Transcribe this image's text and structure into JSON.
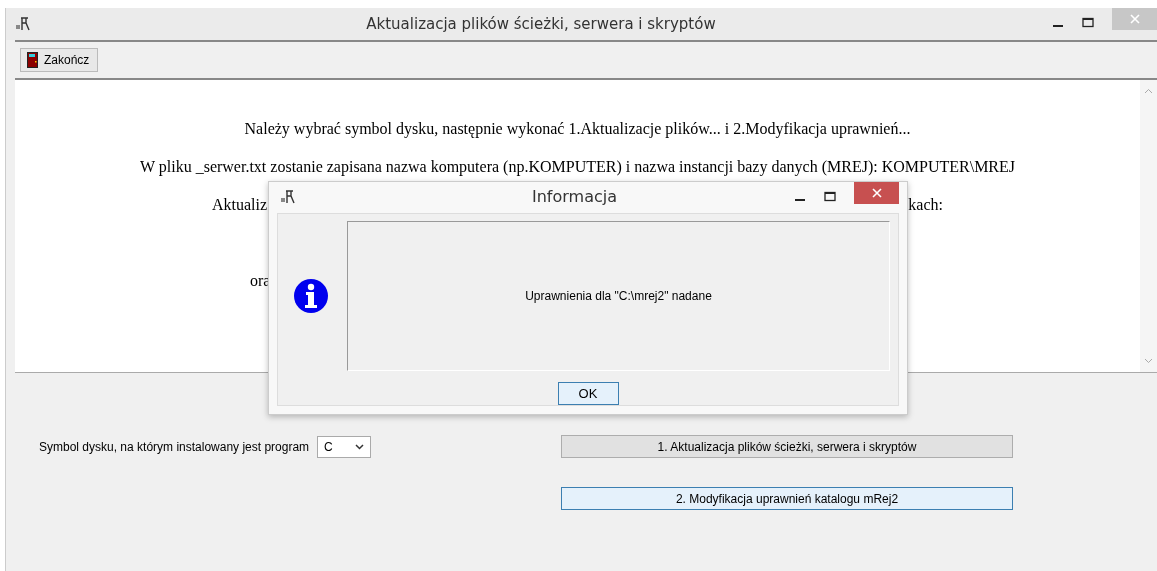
{
  "window": {
    "title": "Aktualizacja plików ścieżki, serwera i skryptów"
  },
  "toolbar": {
    "exit_button": "Zakończ"
  },
  "instructions": [
    {
      "kind": "full",
      "text": "Należy wybrać symbol dysku, następnie wykonać 1.Aktualizacje plików... i 2.Modyfikacja uprawnień..."
    },
    {
      "kind": "full",
      "text": "W pliku _serwer.txt zostanie zapisana nazwa komputera (np.KOMPUTER) i nazwa instancji bazy danych (MREJ): KOMPUTER\\MREJ"
    },
    {
      "kind": "split",
      "left": "Aktualiz",
      "right": "kach:"
    },
    {
      "kind": "split",
      "left": "ora"
    }
  ],
  "drive_label": "Symbol dysku, na którym instalowany jest program",
  "drive_select": {
    "value": "C"
  },
  "buttons": [
    {
      "label": "1. Aktualizacja plików ścieżki, serwera i skryptów",
      "focused": false
    },
    {
      "label": "2. Modyfikacja uprawnień katalogu mRej2",
      "focused": true
    }
  ],
  "dialog": {
    "title": "Informacja",
    "message": "Uprawnienia dla \"C:\\mrej2\" nadane",
    "button": "OK"
  }
}
